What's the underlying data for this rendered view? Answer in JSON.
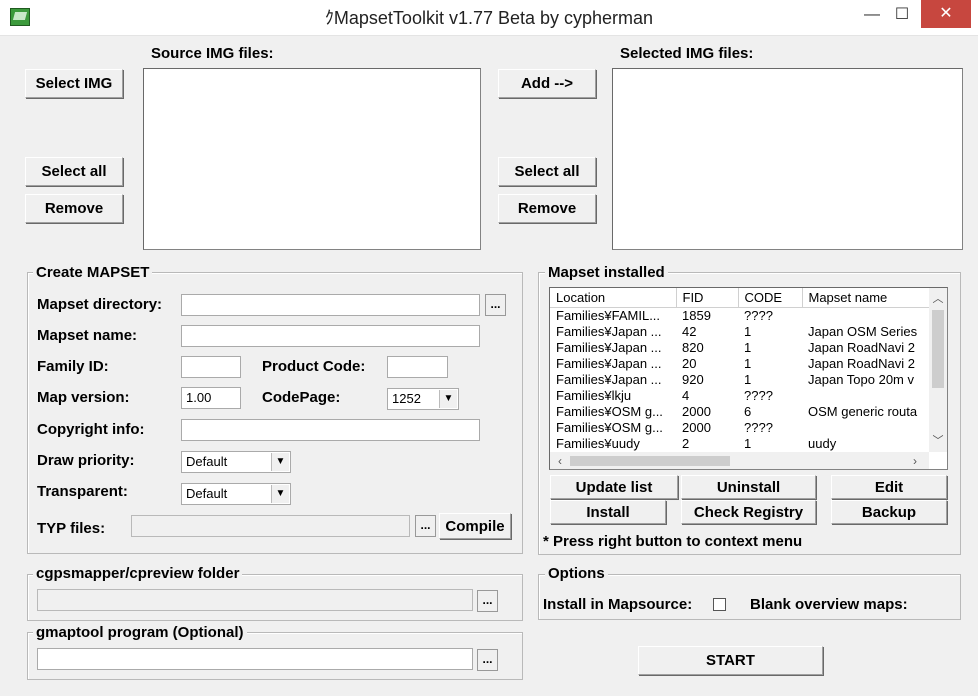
{
  "window": {
    "title": "ｸMapsetToolkit v1.77 Beta by cypherman",
    "controls": {
      "minimize": "—",
      "maximize": "☐",
      "close": "✕"
    }
  },
  "source": {
    "label": "Source IMG files:",
    "select_img": "Select IMG",
    "select_all": "Select all",
    "remove": "Remove"
  },
  "selected": {
    "label": "Selected IMG files:",
    "add": "Add -->",
    "select_all": "Select all",
    "remove": "Remove"
  },
  "create": {
    "title": "Create MAPSET",
    "mapset_directory_label": "Mapset directory:",
    "mapset_directory_value": "",
    "mapset_name_label": "Mapset name:",
    "mapset_name_value": "",
    "family_id_label": "Family ID:",
    "family_id_value": "",
    "product_code_label": "Product Code:",
    "product_code_value": "",
    "map_version_label": "Map version:",
    "map_version_value": "1.00",
    "codepage_label": "CodePage:",
    "codepage_value": "1252",
    "copyright_label": "Copyright info:",
    "copyright_value": "",
    "draw_priority_label": "Draw priority:",
    "draw_priority_value": "Default",
    "transparent_label": "Transparent:",
    "transparent_value": "Default",
    "typ_label": "TYP files:",
    "browse": "...",
    "compile": "Compile"
  },
  "installed": {
    "title": "Mapset installed",
    "columns": [
      "Location",
      "FID",
      "CODE",
      "Mapset name"
    ],
    "rows": [
      [
        "Families¥FAMIL...",
        "1859",
        "????",
        ""
      ],
      [
        "Families¥Japan ...",
        "42",
        "1",
        "Japan OSM Series"
      ],
      [
        "Families¥Japan ...",
        "820",
        "1",
        "Japan RoadNavi 2"
      ],
      [
        "Families¥Japan ...",
        "20",
        "1",
        "Japan RoadNavi 2"
      ],
      [
        "Families¥Japan ...",
        "920",
        "1",
        "Japan Topo 20m v"
      ],
      [
        "Families¥lkju",
        "4",
        "????",
        ""
      ],
      [
        "Families¥OSM g...",
        "2000",
        "6",
        "OSM generic routa"
      ],
      [
        "Families¥OSM g...",
        "2000",
        "????",
        ""
      ],
      [
        "Families¥uudy",
        "2",
        "1",
        "uudy"
      ]
    ],
    "update_list": "Update list",
    "uninstall": "Uninstall",
    "edit": "Edit",
    "install": "Install",
    "check_registry": "Check Registry",
    "backup": "Backup",
    "note": "* Press right button to context menu"
  },
  "cgps": {
    "title": "cgpsmapper/cpreview folder",
    "value": "",
    "browse": "..."
  },
  "gmaptool": {
    "title": "gmaptool program (Optional)",
    "value": "",
    "browse": "..."
  },
  "options": {
    "title": "Options",
    "install_in_mapsource": "Install in Mapsource:",
    "blank_overview": "Blank overview maps:"
  },
  "start": "START"
}
